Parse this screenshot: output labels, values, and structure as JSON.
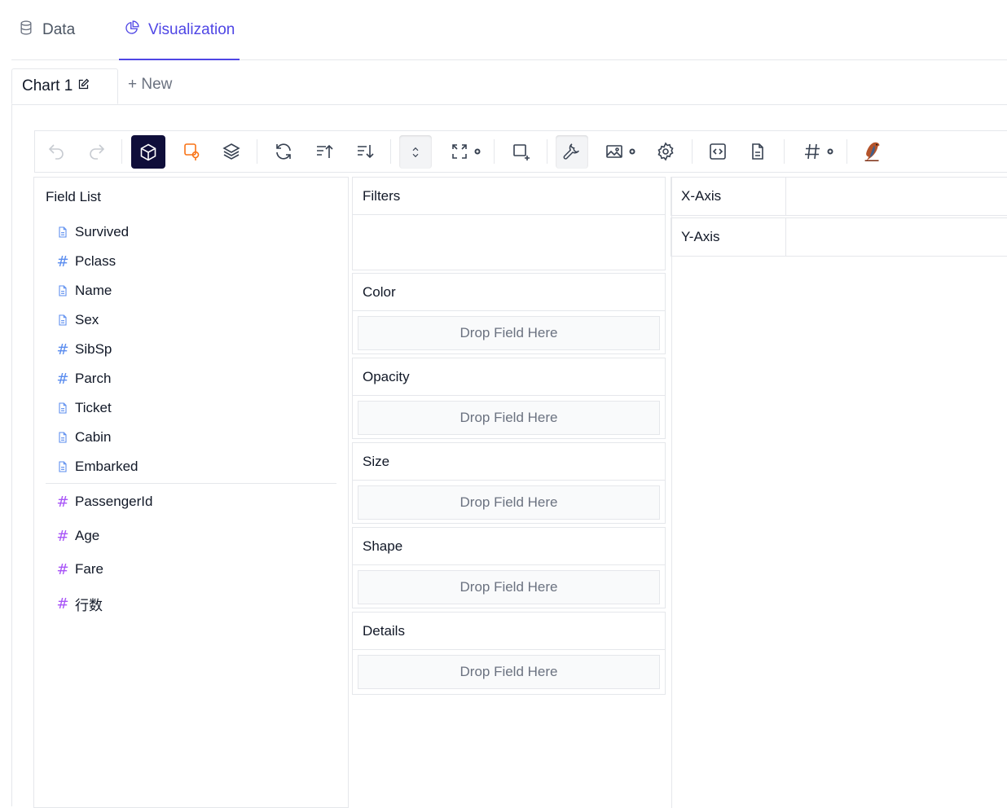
{
  "top_tabs": {
    "data": "Data",
    "visualization": "Visualization"
  },
  "chart_tabs": {
    "current": "Chart 1",
    "new": "+ New"
  },
  "toolbar": {
    "icons": [
      "undo-icon",
      "redo-icon",
      "cube-icon",
      "shape-pin-icon",
      "layers-icon",
      "refresh-icon",
      "sort-ascending-icon",
      "sort-descending-icon",
      "chevron-up-down-icon",
      "expand-icon",
      "crop-add-icon",
      "wrench-icon",
      "image-icon",
      "gear-icon",
      "code-icon",
      "document-icon",
      "hash-icon",
      "bird-logo-icon"
    ],
    "colors": {
      "active_bg": "#0f0e3a",
      "orange": "#f97316"
    }
  },
  "field_list": {
    "title": "Field List",
    "dimensions": [
      {
        "name": "Survived",
        "type": "text"
      },
      {
        "name": "Pclass",
        "type": "number"
      },
      {
        "name": "Name",
        "type": "text"
      },
      {
        "name": "Sex",
        "type": "text"
      },
      {
        "name": "SibSp",
        "type": "number"
      },
      {
        "name": "Parch",
        "type": "number"
      },
      {
        "name": "Ticket",
        "type": "text"
      },
      {
        "name": "Cabin",
        "type": "text"
      },
      {
        "name": "Embarked",
        "type": "text"
      }
    ],
    "measures": [
      {
        "name": "PassengerId"
      },
      {
        "name": "Age"
      },
      {
        "name": "Fare"
      },
      {
        "name": "行数"
      }
    ],
    "colors": {
      "dimension": "#5b8def",
      "measure": "#a855f7"
    }
  },
  "encodings": {
    "filters": "Filters",
    "color": "Color",
    "opacity": "Opacity",
    "size": "Size",
    "shape": "Shape",
    "details": "Details",
    "drop_placeholder": "Drop Field Here"
  },
  "axes": {
    "x": "X-Axis",
    "y": "Y-Axis"
  },
  "accent": "#4f46e5"
}
